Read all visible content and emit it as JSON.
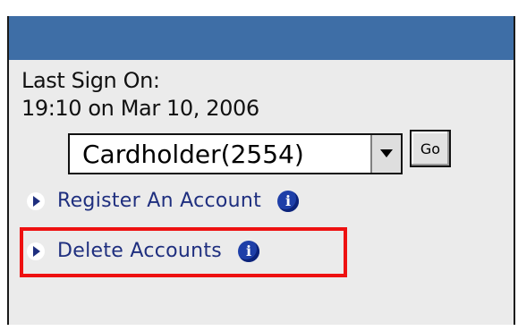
{
  "last_sign_on": {
    "label": "Last Sign On:",
    "time": "19:10 on Mar 10, 2006"
  },
  "account_select": {
    "value": "Cardholder(2554)"
  },
  "go_button": {
    "label": "Go"
  },
  "links": [
    {
      "label": "Register An Account",
      "info_glyph": "i"
    },
    {
      "label": "Delete Accounts",
      "info_glyph": "i"
    }
  ],
  "colors": {
    "header_bar": "#3e6ea6",
    "panel_bg": "#ebebeb",
    "link_text": "#1f2f7f",
    "info_icon": "#1e3fa8",
    "highlight": "#ee1111"
  },
  "icons": {
    "bullet": "play-triangle-icon",
    "info": "info-icon",
    "dropdown": "chevron-down-icon"
  }
}
